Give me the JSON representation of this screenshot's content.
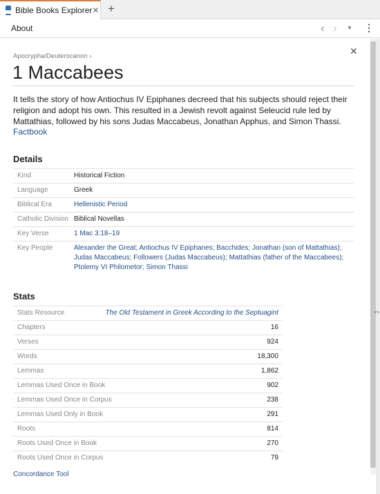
{
  "tab": {
    "title": "Bible Books Explorer",
    "close": "✕",
    "new_tab": "+"
  },
  "toolbar": {
    "about": "About",
    "back": "‹",
    "forward": "›",
    "menu": "▼",
    "more": "⋮"
  },
  "breadcrumb": "Apocrypha/Deuterocanon ›",
  "title": "1 Maccabees",
  "description": "It tells the story of how Antiochus IV Epiphanes decreed that his subjects should reject their religion and adopt his own. This resulted in a Jewish revolt against Seleucid rule led by Mattathias, followed by his sons Judas Maccabeus, Jonathan Apphus, and Simon Thassi.",
  "factbook": "Factbook",
  "details": {
    "heading": "Details",
    "kind_label": "Kind",
    "kind": "Historical Fiction",
    "language_label": "Language",
    "language": "Greek",
    "era_label": "Biblical Era",
    "era": "Hellenistic Period",
    "division_label": "Catholic Division",
    "division": "Biblical Novellas",
    "key_verse_label": "Key Verse",
    "key_verse": "1 Mac 3:18–19",
    "key_people_label": "Key People",
    "key_people": [
      "Alexander the Great",
      "Antiochus IV Epiphanes",
      "Bacchides",
      "Jonathan (son of Mattathias)",
      "Judas Maccabeus",
      "Followers (Judas Maccabeus)",
      "Mattathias (father of the Maccabees)",
      "Ptolemy VI Philometor",
      "Simon Thassi"
    ],
    "separator": ";"
  },
  "stats": {
    "heading": "Stats",
    "rows": [
      {
        "label": "Stats Resource",
        "value": "The Old Testament in Greek According to the Septuagint"
      },
      {
        "label": "Chapters",
        "value": "16"
      },
      {
        "label": "Verses",
        "value": "924"
      },
      {
        "label": "Words",
        "value": "18,300"
      },
      {
        "label": "Lemmas",
        "value": "1,862"
      },
      {
        "label": "Lemmas Used Once in Book",
        "value": "902"
      },
      {
        "label": "Lemmas Used Once in Corpus",
        "value": "238"
      },
      {
        "label": "Lemmas Used Only in Book",
        "value": "291"
      },
      {
        "label": "Roots",
        "value": "814"
      },
      {
        "label": "Roots Used Once in Book",
        "value": "270"
      },
      {
        "label": "Roots Used Once in Corpus",
        "value": "79"
      }
    ]
  },
  "concordance": "Concordance Tool",
  "icons": {
    "app": "app-icon",
    "close": "close-icon",
    "back": "chevron-left-icon",
    "forward": "chevron-right-icon",
    "menu": "chevron-down-icon",
    "more": "more-vertical-icon",
    "panel_close": "close-icon",
    "resize": "resize-arrows-icon"
  },
  "colors": {
    "link": "#1d4e8f",
    "tab_accent": "#e8792b",
    "app_icon": "#2e6fb6"
  }
}
